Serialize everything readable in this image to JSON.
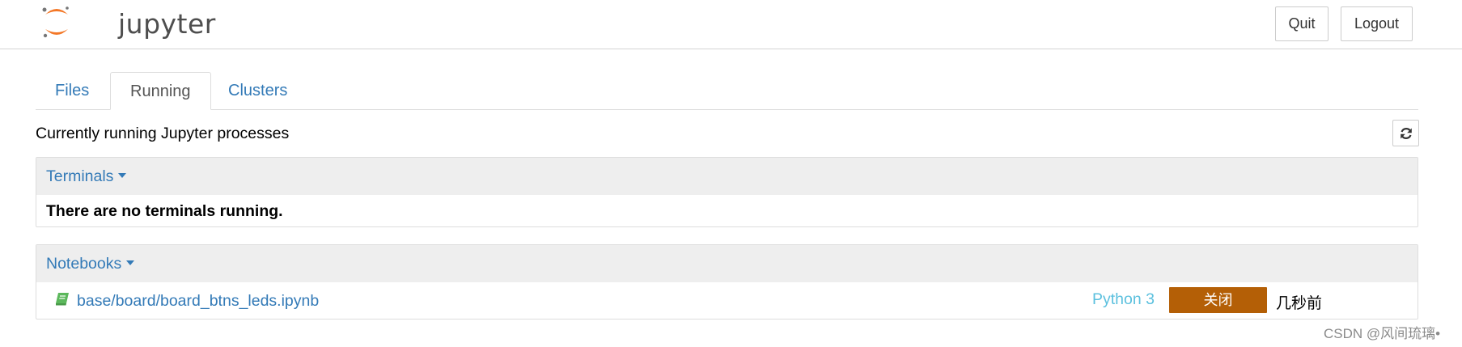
{
  "header": {
    "logo_text": "jupyter",
    "quit_label": "Quit",
    "logout_label": "Logout"
  },
  "tabs": [
    {
      "label": "Files",
      "active": false
    },
    {
      "label": "Running",
      "active": true
    },
    {
      "label": "Clusters",
      "active": false
    }
  ],
  "running": {
    "caption": "Currently running Jupyter processes",
    "refresh_icon": "refresh-icon",
    "terminals": {
      "title": "Terminals",
      "empty_message": "There are no terminals running."
    },
    "notebooks": {
      "title": "Notebooks",
      "items": [
        {
          "name": "base/board/board_btns_leds.ipynb",
          "kernel": "Python 3",
          "action_label": "关闭",
          "last_activity": "几秒前",
          "icon": "notebook-book-icon"
        }
      ]
    }
  },
  "watermark": "CSDN @风间琉璃•",
  "colors": {
    "link": "#337ab7",
    "kernel": "#5bc0de",
    "shutdown": "#b45f06",
    "logo_orange": "#f37726",
    "notebook_icon": "#5cb85c"
  }
}
